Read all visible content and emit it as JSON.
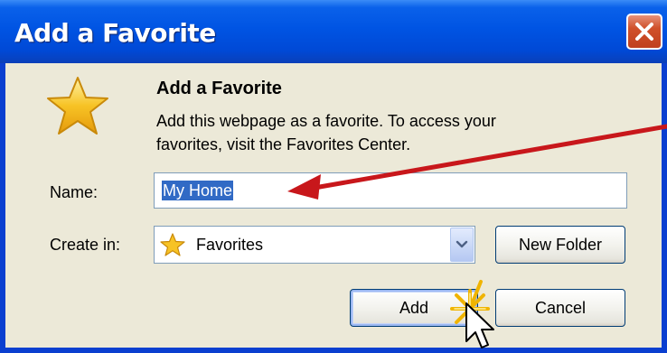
{
  "window": {
    "title": "Add a Favorite",
    "close_icon": "close-icon"
  },
  "header": {
    "icon": "star-icon",
    "heading": "Add a Favorite",
    "description_line1": "Add this webpage as a favorite. To access your",
    "description_line2": "favorites, visit the Favorites Center."
  },
  "form": {
    "name_label": "Name:",
    "name_value": "My Home",
    "create_in_label": "Create in:",
    "create_in_icon": "star-icon",
    "create_in_value": "Favorites",
    "dropdown_icon": "chevron-down-icon",
    "new_folder_label": "New Folder"
  },
  "buttons": {
    "add_label": "Add",
    "cancel_label": "Cancel"
  },
  "annotations": {
    "arrow_icon": "red-arrow-icon",
    "cursor_icon": "mouse-pointer-icon",
    "click_burst_icon": "click-burst-icon"
  },
  "colors": {
    "titlebar": "#0054e3",
    "client_bg": "#ece9d8",
    "selection": "#316ac5",
    "arrow": "#c8171b",
    "close_button": "#d0502a",
    "star": "#f7c325"
  }
}
